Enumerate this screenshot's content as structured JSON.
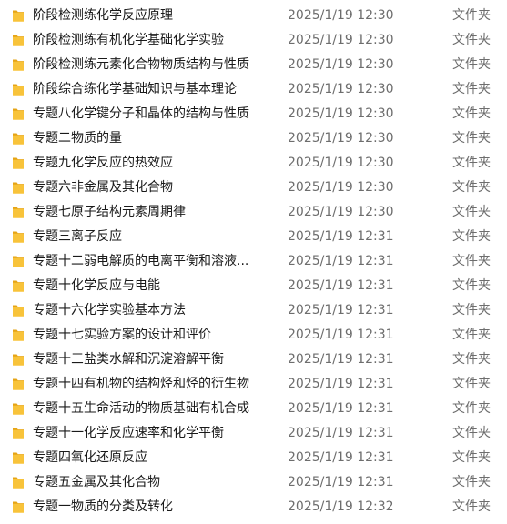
{
  "colors": {
    "folder_front": "#f8c33a",
    "folder_back": "#e6a416",
    "name_text": "#1a1a1a",
    "meta_text": "#6d6d6d"
  },
  "files": [
    {
      "name": "阶段检测练化学反应原理",
      "modified": "2025/1/19 12:30",
      "type": "文件夹",
      "icon": "folder-icon"
    },
    {
      "name": "阶段检测练有机化学基础化学实验",
      "modified": "2025/1/19 12:30",
      "type": "文件夹",
      "icon": "folder-icon"
    },
    {
      "name": "阶段检测练元素化合物物质结构与性质",
      "modified": "2025/1/19 12:30",
      "type": "文件夹",
      "icon": "folder-icon"
    },
    {
      "name": "阶段综合练化学基础知识与基本理论",
      "modified": "2025/1/19 12:30",
      "type": "文件夹",
      "icon": "folder-icon"
    },
    {
      "name": "专题八化学键分子和晶体的结构与性质",
      "modified": "2025/1/19 12:30",
      "type": "文件夹",
      "icon": "folder-icon"
    },
    {
      "name": "专题二物质的量",
      "modified": "2025/1/19 12:30",
      "type": "文件夹",
      "icon": "folder-icon"
    },
    {
      "name": "专题九化学反应的热效应",
      "modified": "2025/1/19 12:30",
      "type": "文件夹",
      "icon": "folder-icon"
    },
    {
      "name": "专题六非金属及其化合物",
      "modified": "2025/1/19 12:30",
      "type": "文件夹",
      "icon": "folder-icon"
    },
    {
      "name": "专题七原子结构元素周期律",
      "modified": "2025/1/19 12:30",
      "type": "文件夹",
      "icon": "folder-icon"
    },
    {
      "name": "专题三离子反应",
      "modified": "2025/1/19 12:31",
      "type": "文件夹",
      "icon": "folder-icon"
    },
    {
      "name": "专题十二弱电解质的电离平衡和溶液...",
      "modified": "2025/1/19 12:31",
      "type": "文件夹",
      "icon": "folder-icon"
    },
    {
      "name": "专题十化学反应与电能",
      "modified": "2025/1/19 12:31",
      "type": "文件夹",
      "icon": "folder-icon"
    },
    {
      "name": "专题十六化学实验基本方法",
      "modified": "2025/1/19 12:31",
      "type": "文件夹",
      "icon": "folder-icon"
    },
    {
      "name": "专题十七实验方案的设计和评价",
      "modified": "2025/1/19 12:31",
      "type": "文件夹",
      "icon": "folder-icon"
    },
    {
      "name": "专题十三盐类水解和沉淀溶解平衡",
      "modified": "2025/1/19 12:31",
      "type": "文件夹",
      "icon": "folder-icon"
    },
    {
      "name": "专题十四有机物的结构烃和烃的衍生物",
      "modified": "2025/1/19 12:31",
      "type": "文件夹",
      "icon": "folder-icon"
    },
    {
      "name": "专题十五生命活动的物质基础有机合成",
      "modified": "2025/1/19 12:31",
      "type": "文件夹",
      "icon": "folder-icon"
    },
    {
      "name": "专题十一化学反应速率和化学平衡",
      "modified": "2025/1/19 12:31",
      "type": "文件夹",
      "icon": "folder-icon"
    },
    {
      "name": "专题四氧化还原反应",
      "modified": "2025/1/19 12:31",
      "type": "文件夹",
      "icon": "folder-icon"
    },
    {
      "name": "专题五金属及其化合物",
      "modified": "2025/1/19 12:31",
      "type": "文件夹",
      "icon": "folder-icon"
    },
    {
      "name": "专题一物质的分类及转化",
      "modified": "2025/1/19 12:32",
      "type": "文件夹",
      "icon": "folder-icon"
    }
  ]
}
